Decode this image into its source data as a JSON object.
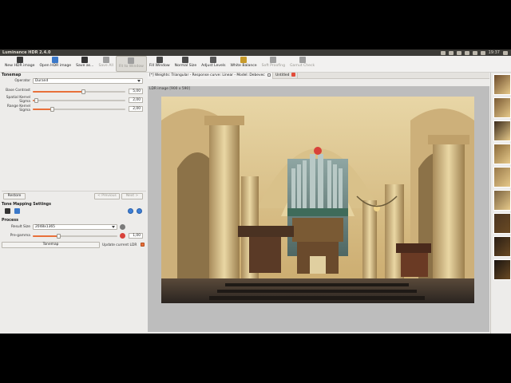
{
  "app": {
    "window_title": "Luminance HDR 2.4.0",
    "clock": "19:37"
  },
  "toolbar": {
    "buttons": [
      {
        "label": "New HDR image",
        "icon": "new-hdr-icon",
        "color": "#3b3b3b",
        "enabled": true
      },
      {
        "label": "Open HDR image",
        "icon": "open-hdr-icon",
        "color": "#3a78c9",
        "enabled": true
      },
      {
        "label": "Save as...",
        "icon": "save-icon",
        "color": "#333333",
        "enabled": true
      },
      {
        "label": "Save All",
        "icon": "save-all-icon",
        "color": "#9e9e9e",
        "enabled": false
      },
      {
        "label": "Fit to Window",
        "icon": "fit-window-icon",
        "color": "#9e9e9e",
        "enabled": false
      },
      {
        "label": "Fill Window",
        "icon": "fill-window-icon",
        "color": "#4a4a4a",
        "enabled": true
      },
      {
        "label": "Normal Size",
        "icon": "normal-size-icon",
        "color": "#4a4a4a",
        "enabled": true
      },
      {
        "label": "Adjust Levels",
        "icon": "adjust-levels-icon",
        "color": "#5a5a5a",
        "enabled": true
      },
      {
        "label": "White Balance",
        "icon": "white-balance-icon",
        "color": "#c79a2a",
        "enabled": true
      },
      {
        "label": "Soft Proofing",
        "icon": "soft-proofing-icon",
        "color": "#9e9e9e",
        "enabled": false
      },
      {
        "label": "Gamut Check",
        "icon": "gamut-check-icon",
        "color": "#9e9e9e",
        "enabled": false
      }
    ]
  },
  "tonemap": {
    "section_title": "Tonemap",
    "operator_label": "Operator",
    "operator_value": "Durand",
    "params": [
      {
        "label": "Base Contrast",
        "value": "5,00",
        "fraction": 0.55
      },
      {
        "label": "Spatial Kernel Sigma",
        "value": "2,00",
        "fraction": 0.02
      },
      {
        "label": "Range Kernel Sigma",
        "value": "2,00",
        "fraction": 0.2
      }
    ],
    "restore_label": "Restore",
    "previous_label": "< Previous",
    "next_label": "Next >"
  },
  "settings": {
    "section_title": "Tone Mapping Settings"
  },
  "process": {
    "section_title": "Process",
    "result_size_label": "Result Size",
    "result_size_value": "2048x1365",
    "pregamma_label": "Pre-gamma",
    "pregamma_value": "1,00",
    "pregamma_fraction": 0.3,
    "tonemap_button": "Tonemap",
    "update_label": "Update current LDR"
  },
  "tabs": [
    {
      "label": "[*] Weights: Triangular - Response curve: Linear - Model: Debevec",
      "active": true,
      "close": "x"
    },
    {
      "label": "Untitled",
      "active": false,
      "close": "red"
    }
  ],
  "viewer": {
    "label": "LDR image [900 x 590]"
  },
  "dock": {
    "icons": [
      {
        "name": "ubuntu-icon",
        "color": "#e0582c"
      },
      {
        "name": "firefox-icon",
        "color": "#d96c2a"
      },
      {
        "name": "files-icon",
        "color": "#c9a23e"
      },
      {
        "name": "software-center-icon",
        "color": "#d9542a"
      },
      {
        "name": "settings-icon",
        "color": "#8e8e8e"
      },
      {
        "name": "chrome-icon",
        "color": "#3b7fd6"
      },
      {
        "name": "terminal-icon",
        "color": "#3a3a3a"
      },
      {
        "name": "vlc-icon",
        "color": "#e88a1a"
      },
      {
        "name": "text-editor-icon",
        "color": "#7b6aa8"
      },
      {
        "name": "gimp-icon",
        "color": "#6b5e44"
      },
      {
        "name": "inkscape-icon",
        "color": "#555555"
      },
      {
        "name": "krita-icon",
        "color": "#6a48a0"
      },
      {
        "name": "photos-icon",
        "color": "#d14d8a"
      },
      {
        "name": "blender-icon",
        "color": "#e57b27"
      },
      {
        "name": "writer-icon",
        "color": "#3e73c6"
      },
      {
        "name": "calc-icon",
        "color": "#3f8c3b"
      },
      {
        "name": "impress-icon",
        "color": "#c64a2a"
      },
      {
        "name": "shotwell-icon",
        "color": "#5f8ac0"
      },
      {
        "name": "scribus-icon",
        "color": "#8a3b3b"
      },
      {
        "name": "darktable-icon",
        "color": "#444444"
      },
      {
        "name": "mail-icon",
        "color": "#d8423a"
      },
      {
        "name": "calendar-icon",
        "color": "#f2f2f2"
      },
      {
        "name": "monitor-icon",
        "color": "#4a4a4a"
      },
      {
        "name": "hdr-icon",
        "color": "#c8862a"
      },
      {
        "name": "skype-icon",
        "color": "#2a9ad8"
      },
      {
        "name": "chat-icon",
        "color": "#e8e8e8"
      },
      {
        "name": "notes-icon",
        "color": "#f0f0f0"
      },
      {
        "name": "screenshot-icon",
        "color": "#606060"
      },
      {
        "name": "calculator-icon",
        "color": "#d8d8d8"
      },
      {
        "name": "keyboard-icon",
        "color": "#6a6a6a"
      },
      {
        "name": "clock-icon",
        "color": "#2b6fb8"
      },
      {
        "name": "music-icon",
        "color": "#8a42b0"
      },
      {
        "name": "viewer-icon",
        "color": "#4aa04a"
      },
      {
        "name": "music-player-icon",
        "color": "#c43d6b"
      },
      {
        "name": "system-monitor-icon",
        "color": "#dadada"
      },
      {
        "name": "nautilus-icon",
        "color": "#7aa0c8"
      },
      {
        "name": "steam-icon",
        "color": "#2a4f76"
      },
      {
        "name": "java-icon",
        "color": "#e8a64a"
      },
      {
        "name": "trash-icon",
        "color": "#e0e0e0"
      }
    ]
  }
}
